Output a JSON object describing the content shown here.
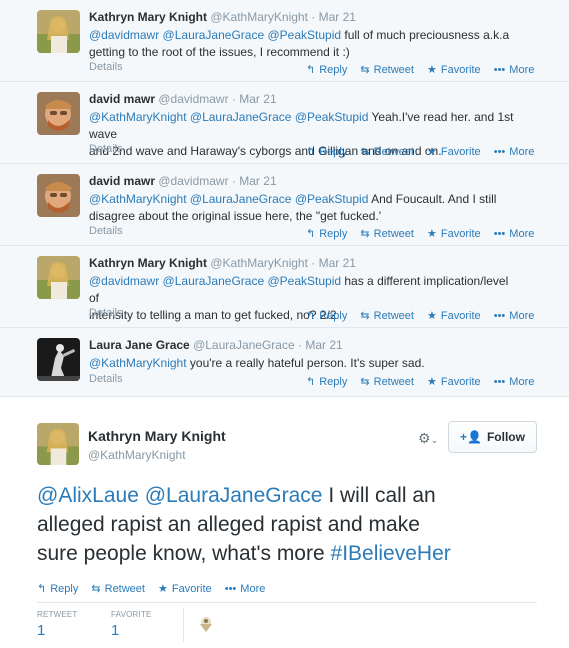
{
  "actions": {
    "reply": "Reply",
    "retweet": "Retweet",
    "favorite": "Favorite",
    "more": "More",
    "details": "Details"
  },
  "replies": [
    {
      "name": "Kathryn Mary Knight",
      "handle": "@KathMaryKnight",
      "time": "Mar 21",
      "mentions": [
        "@davidmawr",
        "@LauraJaneGrace",
        "@PeakStupid"
      ],
      "text_line1": "full of much preciousness a.k.a",
      "text_line2": "getting to the root of the issues, I recommend it :)"
    },
    {
      "name": "david mawr",
      "handle": "@davidmawr",
      "time": "Mar 21",
      "mentions": [
        "@KathMaryKnight",
        "@LauraJaneGrace",
        "@PeakStupid"
      ],
      "text_line1": "Yeah.I've read her. and 1st wave",
      "text_line2": "and 2nd wave and Haraway's cyborgs and Gilligan and on and on."
    },
    {
      "name": "david mawr",
      "handle": "@davidmawr",
      "time": "Mar 21",
      "mentions": [
        "@KathMaryKnight",
        "@LauraJaneGrace",
        "@PeakStupid"
      ],
      "text_line1": "And Foucault.  And I still",
      "text_line2": "disagree about the original issue here, the \"get fucked.'"
    },
    {
      "name": "Kathryn Mary Knight",
      "handle": "@KathMaryKnight",
      "time": "Mar 21",
      "mentions": [
        "@davidmawr",
        "@LauraJaneGrace",
        "@PeakStupid"
      ],
      "text_line1": "has a different implication/level of",
      "text_line2": "intensity to telling a man to get fucked, no? 2/2"
    },
    {
      "name": "Laura Jane Grace",
      "handle": "@LauraJaneGrace",
      "time": "Mar 21",
      "mentions": [
        "@KathMaryKnight"
      ],
      "text_line1": "you're a really hateful person. It's super sad.",
      "text_line2": ""
    }
  ],
  "focus": {
    "name": "Kathryn Mary Knight",
    "handle": "@KathMaryKnight",
    "follow_label": "Follow",
    "mentions": [
      "@AlixLaue",
      "@LauraJaneGrace"
    ],
    "text_part1": "I will call an",
    "text_part2": "alleged rapist an alleged rapist and make",
    "text_part3": "sure people know, what's more",
    "hashtag": "#IBelieveHer",
    "retweet_label": "RETWEET",
    "retweet_count": "1",
    "favorite_label": "FAVORITE",
    "favorite_count": "1"
  },
  "icons": {
    "reply": "reply-arrow",
    "retweet": "retweet-arrows",
    "favorite": "star",
    "more": "ellipsis",
    "settings": "gear",
    "follow": "add-person"
  },
  "colors": {
    "link": "#2b7bb9",
    "meta": "#8899a6",
    "thread_bg": "#f5f8fa"
  }
}
